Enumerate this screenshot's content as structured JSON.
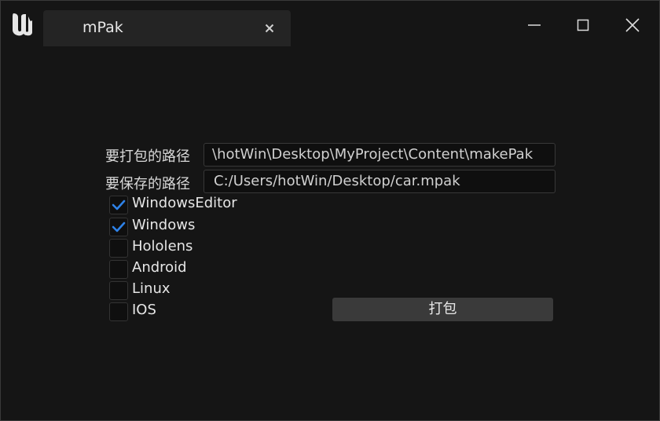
{
  "app": {
    "logo_icon": "unreal-engine-logo-icon"
  },
  "tab": {
    "title": "mPak",
    "close_icon": "close-icon"
  },
  "window_controls": {
    "minimize_icon": "minimize-icon",
    "maximize_icon": "maximize-icon",
    "close_icon": "close-icon"
  },
  "form": {
    "source_label": "要打包的路径",
    "source_value": "\\hotWin\\Desktop\\MyProject\\Content\\makePak",
    "output_label": "要保存的路径",
    "output_value": "C:/Users/hotWin/Desktop/car.mpak"
  },
  "platforms": [
    {
      "label": "WindowsEditor",
      "checked": true
    },
    {
      "label": "Windows",
      "checked": true
    },
    {
      "label": "Hololens",
      "checked": false
    },
    {
      "label": "Android",
      "checked": false
    },
    {
      "label": "Linux",
      "checked": false
    },
    {
      "label": "IOS",
      "checked": false
    }
  ],
  "pack_button": {
    "label": "打包"
  },
  "colors": {
    "background": "#151515",
    "tab": "#242424",
    "input_bg": "#0f0f0f",
    "check_accent": "#2e82e8",
    "button_bg": "#3a3a3a"
  }
}
